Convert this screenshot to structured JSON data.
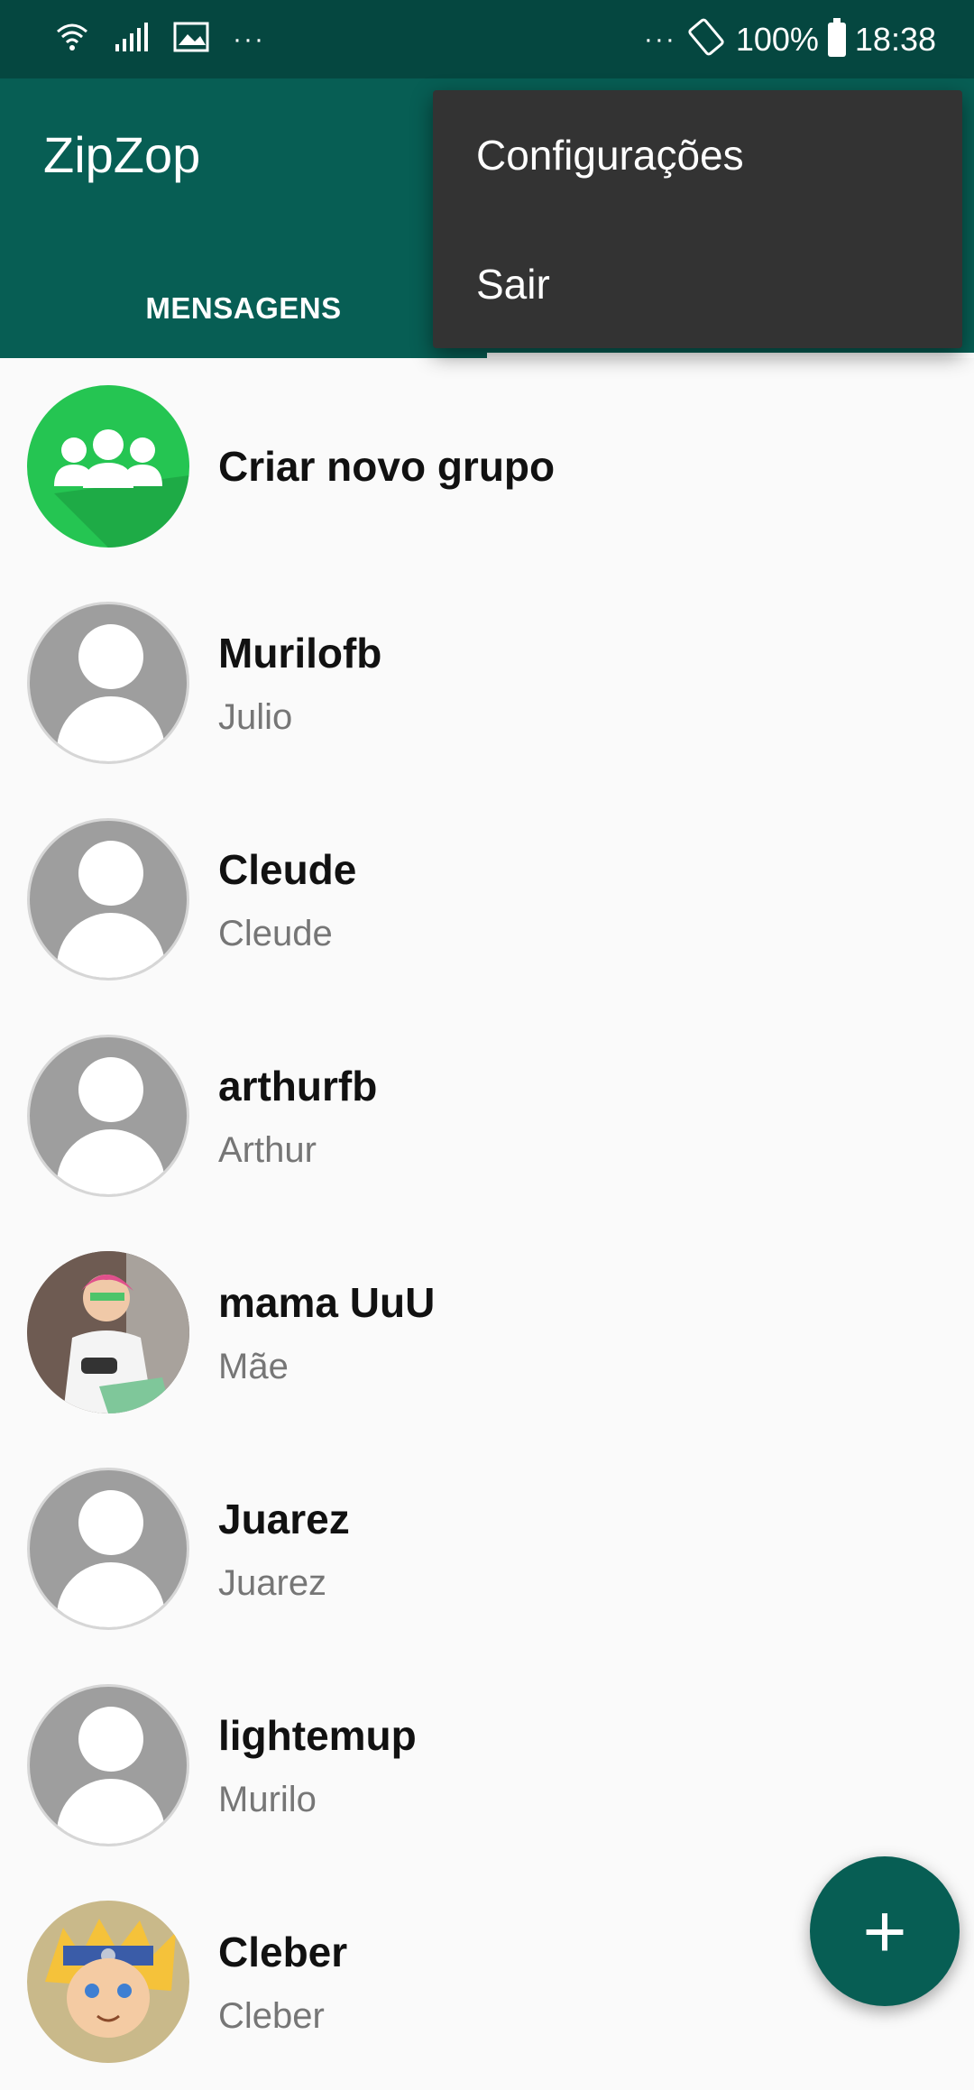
{
  "status_bar": {
    "left_dots": "···",
    "right_dots": "···",
    "battery": "100%",
    "time": "18:38",
    "icons": [
      "wifi-icon",
      "signal-icon",
      "image-icon",
      "rotate-icon",
      "battery-icon"
    ]
  },
  "app_bar": {
    "title": "ZipZop",
    "tabs": [
      {
        "label": "MENSAGENS",
        "selected": false
      }
    ]
  },
  "overflow_menu": {
    "items": [
      {
        "label": "Configurações"
      },
      {
        "label": "Sair"
      }
    ]
  },
  "contacts": [
    {
      "name": "Criar novo grupo",
      "subtitle": "",
      "avatar": "group-icon"
    },
    {
      "name": "Murilofb",
      "subtitle": "Julio",
      "avatar": "default-avatar-icon"
    },
    {
      "name": "Cleude",
      "subtitle": "Cleude",
      "avatar": "default-avatar-icon"
    },
    {
      "name": "arthurfb",
      "subtitle": "Arthur",
      "avatar": "default-avatar-icon"
    },
    {
      "name": "mama UuU",
      "subtitle": "Mãe",
      "avatar": "photo"
    },
    {
      "name": "Juarez",
      "subtitle": "Juarez",
      "avatar": "default-avatar-icon"
    },
    {
      "name": "lightemup",
      "subtitle": "Murilo",
      "avatar": "default-avatar-icon"
    },
    {
      "name": "Cleber",
      "subtitle": "Cleber",
      "avatar": "photo"
    }
  ],
  "fab": {
    "label": "+",
    "icon": "plus-icon"
  },
  "colors": {
    "status_bar": "#054740",
    "app_bar": "#075e54",
    "menu": "#333333",
    "group_avatar": "#25c552",
    "default_avatar": "#9e9e9e"
  }
}
